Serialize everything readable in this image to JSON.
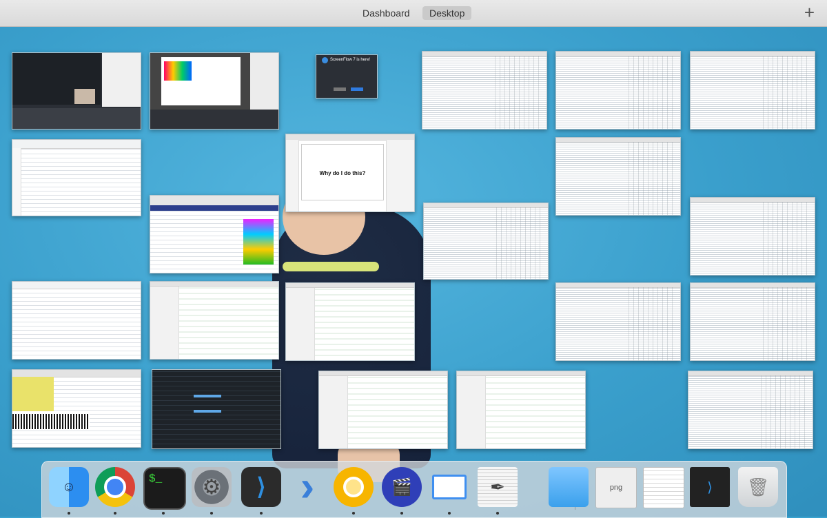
{
  "spaces_bar": {
    "tabs": [
      {
        "label": "Dashboard",
        "active": false
      },
      {
        "label": "Desktop",
        "active": true
      }
    ],
    "add_label": "+"
  },
  "windows": {
    "keynote_slide_text": "Why do I do this?",
    "screenflow_notice_text": "ScreenFlow 7 is here!"
  },
  "dock": {
    "items": [
      {
        "name": "finder-icon",
        "running": true
      },
      {
        "name": "chrome-icon",
        "running": true
      },
      {
        "name": "terminal-icon",
        "running": true,
        "glyph": "$_"
      },
      {
        "name": "system-preferences-icon",
        "running": true
      },
      {
        "name": "visual-studio-code-icon",
        "running": true
      },
      {
        "name": "prompt-icon",
        "running": false
      },
      {
        "name": "chrome-canary-icon",
        "running": true
      },
      {
        "name": "screenflow-icon",
        "running": true
      },
      {
        "name": "keynote-icon",
        "running": true
      },
      {
        "name": "hex-fiend-icon",
        "running": true
      },
      {
        "name": "folder-icon",
        "running": false
      },
      {
        "name": "png-file-icon",
        "running": false,
        "label": "png"
      },
      {
        "name": "text-file-icon",
        "running": false
      },
      {
        "name": "vscode-window-preview-icon",
        "running": false
      },
      {
        "name": "trash-icon",
        "running": false
      }
    ]
  }
}
